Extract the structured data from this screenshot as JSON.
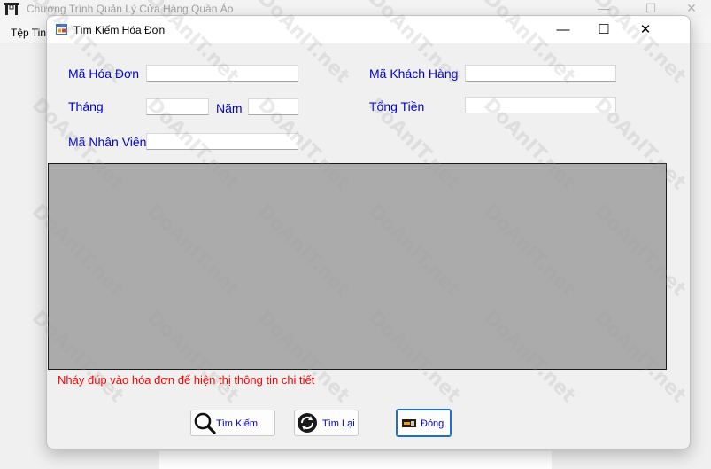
{
  "parent_window": {
    "title": "Chương Trình Quản Lý Cửa Hàng Quần Áo",
    "menu": [
      "Tệp Tin"
    ],
    "controls": {
      "minimize": "—",
      "maximize": "☐",
      "close": "✕"
    }
  },
  "dialog": {
    "title": "Tìm Kiếm Hóa Đơn",
    "controls": {
      "minimize": "—",
      "maximize": "☐",
      "close": "✕"
    }
  },
  "form": {
    "ma_hoa_don_label": "Mã Hóa Đơn",
    "ma_hoa_don_value": "",
    "ma_khach_hang_label": "Mã Khách Hàng",
    "ma_khach_hang_value": "",
    "thang_label": "Tháng",
    "thang_value": "",
    "nam_label": "Năm",
    "nam_value": "",
    "tong_tien_label": "Tổng Tiền",
    "tong_tien_value": "",
    "ma_nhan_vien_label": "Mã Nhân Viên",
    "ma_nhan_vien_value": ""
  },
  "hint": "Nháy đúp vào hóa đơn để hiện thị thông tin chi tiết",
  "buttons": {
    "search": "Tìm Kiếm",
    "reset": "Tìm Lại",
    "close": "Đóng"
  },
  "watermark": {
    "text": "DoAnIT.net"
  },
  "colors": {
    "label": "#0000cc",
    "hint": "#ff0000",
    "grid": "#ababab"
  }
}
